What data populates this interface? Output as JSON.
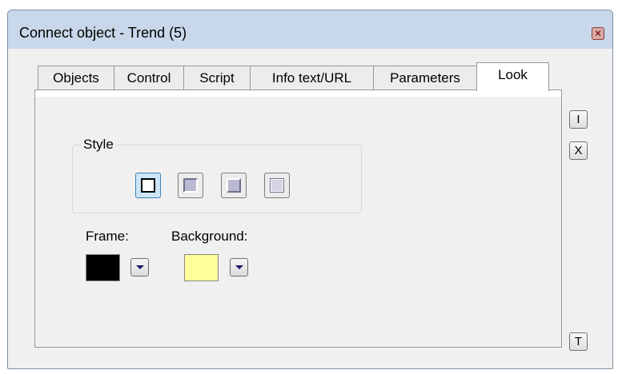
{
  "window": {
    "title": "Connect object - Trend (5)"
  },
  "tabs": [
    {
      "label": "Objects",
      "active": false
    },
    {
      "label": "Control",
      "active": false
    },
    {
      "label": "Script",
      "active": false
    },
    {
      "label": "Info text/URL",
      "active": false
    },
    {
      "label": "Parameters",
      "active": false
    },
    {
      "label": "Look",
      "active": true
    }
  ],
  "look": {
    "style_group_label": "Style",
    "style_options": [
      {
        "name": "flat",
        "selected": true
      },
      {
        "name": "sunken",
        "selected": false
      },
      {
        "name": "raised",
        "selected": false
      },
      {
        "name": "etched",
        "selected": false
      }
    ],
    "frame_label": "Frame:",
    "frame_color": "#000000",
    "background_label": "Background:",
    "background_color": "#ffff99"
  },
  "side_buttons": {
    "top": "I",
    "middle": "X",
    "bottom": "T"
  },
  "colors": {
    "titlebar": "#c8d8ea",
    "selected_accent": "#3c7fb1",
    "dropdown_arrow": "#1a1a6a"
  }
}
